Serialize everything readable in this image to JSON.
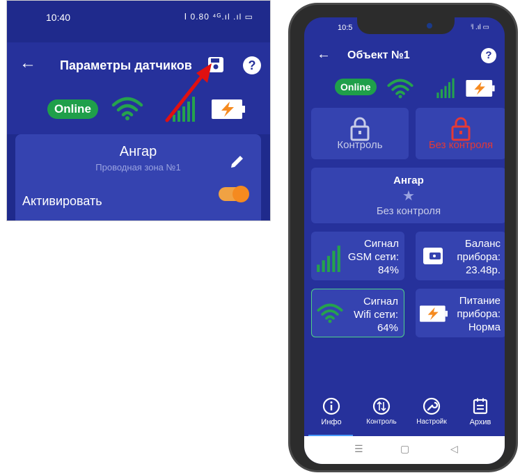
{
  "left_screen": {
    "status_time": "10:40",
    "status_icons": "ⵏ 0.80 ⁴ᴳ.ıl .ıl ▭",
    "title": "Параметры датчиков",
    "back_icon": "arrow-left-icon",
    "save_icon": "floppy-save-icon",
    "help_label": "?",
    "online_label": "Online",
    "sensor": {
      "name": "Ангар",
      "zone": "Проводная зона №1",
      "activate_label": "Активировать",
      "activate_on": true
    }
  },
  "phone": {
    "status_time": "10:5",
    "status_icons": "ⁱl .ıl ▭",
    "title": "Объект №1",
    "help_label": "?",
    "online_label": "Online",
    "tiles": {
      "control_label": "Контроль",
      "no_control_label": "Без контроля",
      "zone_name": "Ангар",
      "zone_status": "Без контроля",
      "gsm_label_1": "Сигнал",
      "gsm_label_2": "GSM сети:",
      "gsm_value": "84%",
      "balance_label_1": "Баланс",
      "balance_label_2": "прибора:",
      "balance_value": "23.48р.",
      "wifi_label_1": "Сигнал",
      "wifi_label_2": "Wifi сети:",
      "wifi_value": "64%",
      "power_label_1": "Питание",
      "power_label_2": "прибора:",
      "power_value": "Норма"
    },
    "nav": [
      {
        "label": "Инфо",
        "icon": "info-icon"
      },
      {
        "label": "Контроль",
        "icon": "control-icon"
      },
      {
        "label": "Настройк",
        "icon": "wrench-icon"
      },
      {
        "label": "Архив",
        "icon": "archive-icon"
      }
    ],
    "sysnav": [
      "☰",
      "▢",
      "◁"
    ]
  },
  "colors": {
    "background_blue": "#26319b",
    "card_blue": "#3543b0",
    "online_green": "#1f9f4a",
    "danger_red": "#e53935",
    "toggle_orange": "#f58a1f"
  }
}
